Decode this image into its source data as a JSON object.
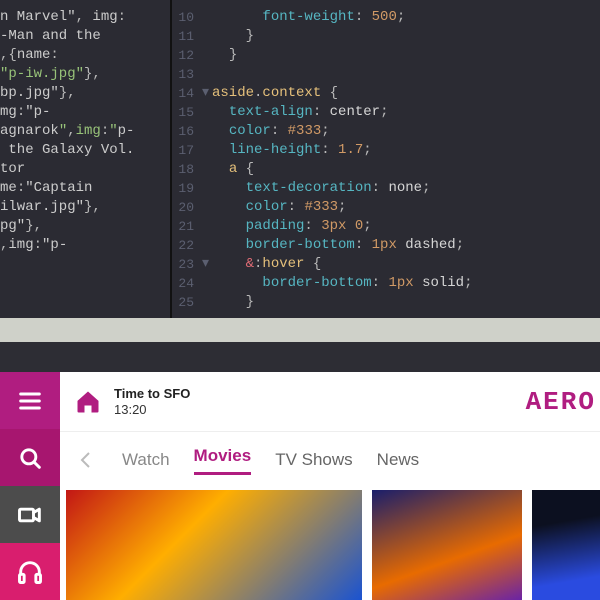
{
  "editor": {
    "left_lines": [
      "n Marvel\", img:",
      "-Man and the",
      ",{name:",
      "\"p-iw.jpg\"},",
      "bp.jpg\"},",
      "mg:\"p-",
      "agnarok\",img:\"p-",
      " the Galaxy Vol.",
      "tor",
      "me:\"Captain",
      "ilwar.jpg\"},",
      "pg\"},",
      ",img:\"p-"
    ],
    "right_lines": [
      {
        "ln": "10",
        "indent": 3,
        "tokens": [
          [
            "s-prop",
            "font-weight"
          ],
          [
            "s-punc",
            ": "
          ],
          [
            "s-num",
            "500"
          ],
          [
            "s-punc",
            ";"
          ]
        ]
      },
      {
        "ln": "11",
        "indent": 2,
        "tokens": [
          [
            "s-punc",
            "}"
          ]
        ]
      },
      {
        "ln": "12",
        "indent": 1,
        "tokens": [
          [
            "s-punc",
            "}"
          ]
        ]
      },
      {
        "ln": "13",
        "indent": 0,
        "tokens": []
      },
      {
        "ln": "14",
        "indent": 0,
        "fold": "▾",
        "tokens": [
          [
            "s-tag",
            "aside"
          ],
          [
            "s-punc",
            "."
          ],
          [
            "s-tag",
            "context"
          ],
          [
            "s-punc",
            " {"
          ]
        ]
      },
      {
        "ln": "15",
        "indent": 1,
        "tokens": [
          [
            "s-prop",
            "text-align"
          ],
          [
            "s-punc",
            ": "
          ],
          [
            "s-plain",
            "center"
          ],
          [
            "s-punc",
            ";"
          ]
        ]
      },
      {
        "ln": "16",
        "indent": 1,
        "tokens": [
          [
            "s-prop",
            "color"
          ],
          [
            "s-punc",
            ": "
          ],
          [
            "s-num",
            "#333"
          ],
          [
            "s-punc",
            ";"
          ]
        ]
      },
      {
        "ln": "17",
        "indent": 1,
        "tokens": [
          [
            "s-prop",
            "line-height"
          ],
          [
            "s-punc",
            ": "
          ],
          [
            "s-num",
            "1.7"
          ],
          [
            "s-punc",
            ";"
          ]
        ]
      },
      {
        "ln": "18",
        "indent": 1,
        "tokens": [
          [
            "s-tag",
            "a"
          ],
          [
            "s-punc",
            " {"
          ]
        ]
      },
      {
        "ln": "19",
        "indent": 2,
        "tokens": [
          [
            "s-prop",
            "text-decoration"
          ],
          [
            "s-punc",
            ": "
          ],
          [
            "s-plain",
            "none"
          ],
          [
            "s-punc",
            ";"
          ]
        ]
      },
      {
        "ln": "20",
        "indent": 2,
        "tokens": [
          [
            "s-prop",
            "color"
          ],
          [
            "s-punc",
            ": "
          ],
          [
            "s-num",
            "#333"
          ],
          [
            "s-punc",
            ";"
          ]
        ]
      },
      {
        "ln": "21",
        "indent": 2,
        "tokens": [
          [
            "s-prop",
            "padding"
          ],
          [
            "s-punc",
            ": "
          ],
          [
            "s-num",
            "3px 0"
          ],
          [
            "s-punc",
            ";"
          ]
        ]
      },
      {
        "ln": "22",
        "indent": 2,
        "tokens": [
          [
            "s-prop",
            "border-bottom"
          ],
          [
            "s-punc",
            ": "
          ],
          [
            "s-num",
            "1px"
          ],
          [
            "s-punc",
            " "
          ],
          [
            "s-plain",
            "dashed"
          ],
          [
            "s-punc",
            ";"
          ]
        ]
      },
      {
        "ln": "23",
        "indent": 2,
        "fold": "▾",
        "tokens": [
          [
            "s-amp",
            "&"
          ],
          [
            "s-punc",
            ":"
          ],
          [
            "s-tag",
            "hover"
          ],
          [
            "s-punc",
            " {"
          ]
        ]
      },
      {
        "ln": "24",
        "indent": 3,
        "tokens": [
          [
            "s-prop",
            "border-bottom"
          ],
          [
            "s-punc",
            ": "
          ],
          [
            "s-num",
            "1px"
          ],
          [
            "s-punc",
            " "
          ],
          [
            "s-plain",
            "solid"
          ],
          [
            "s-punc",
            ";"
          ]
        ]
      },
      {
        "ln": "25",
        "indent": 2,
        "tokens": [
          [
            "s-punc",
            "}"
          ]
        ]
      }
    ]
  },
  "app": {
    "brand": "AERO",
    "destination_label": "Time to SFO",
    "destination_time": "13:20",
    "breadcrumb": "Watch",
    "tabs": [
      "Movies",
      "TV Shows",
      "News"
    ],
    "active_tab": "Movies"
  }
}
